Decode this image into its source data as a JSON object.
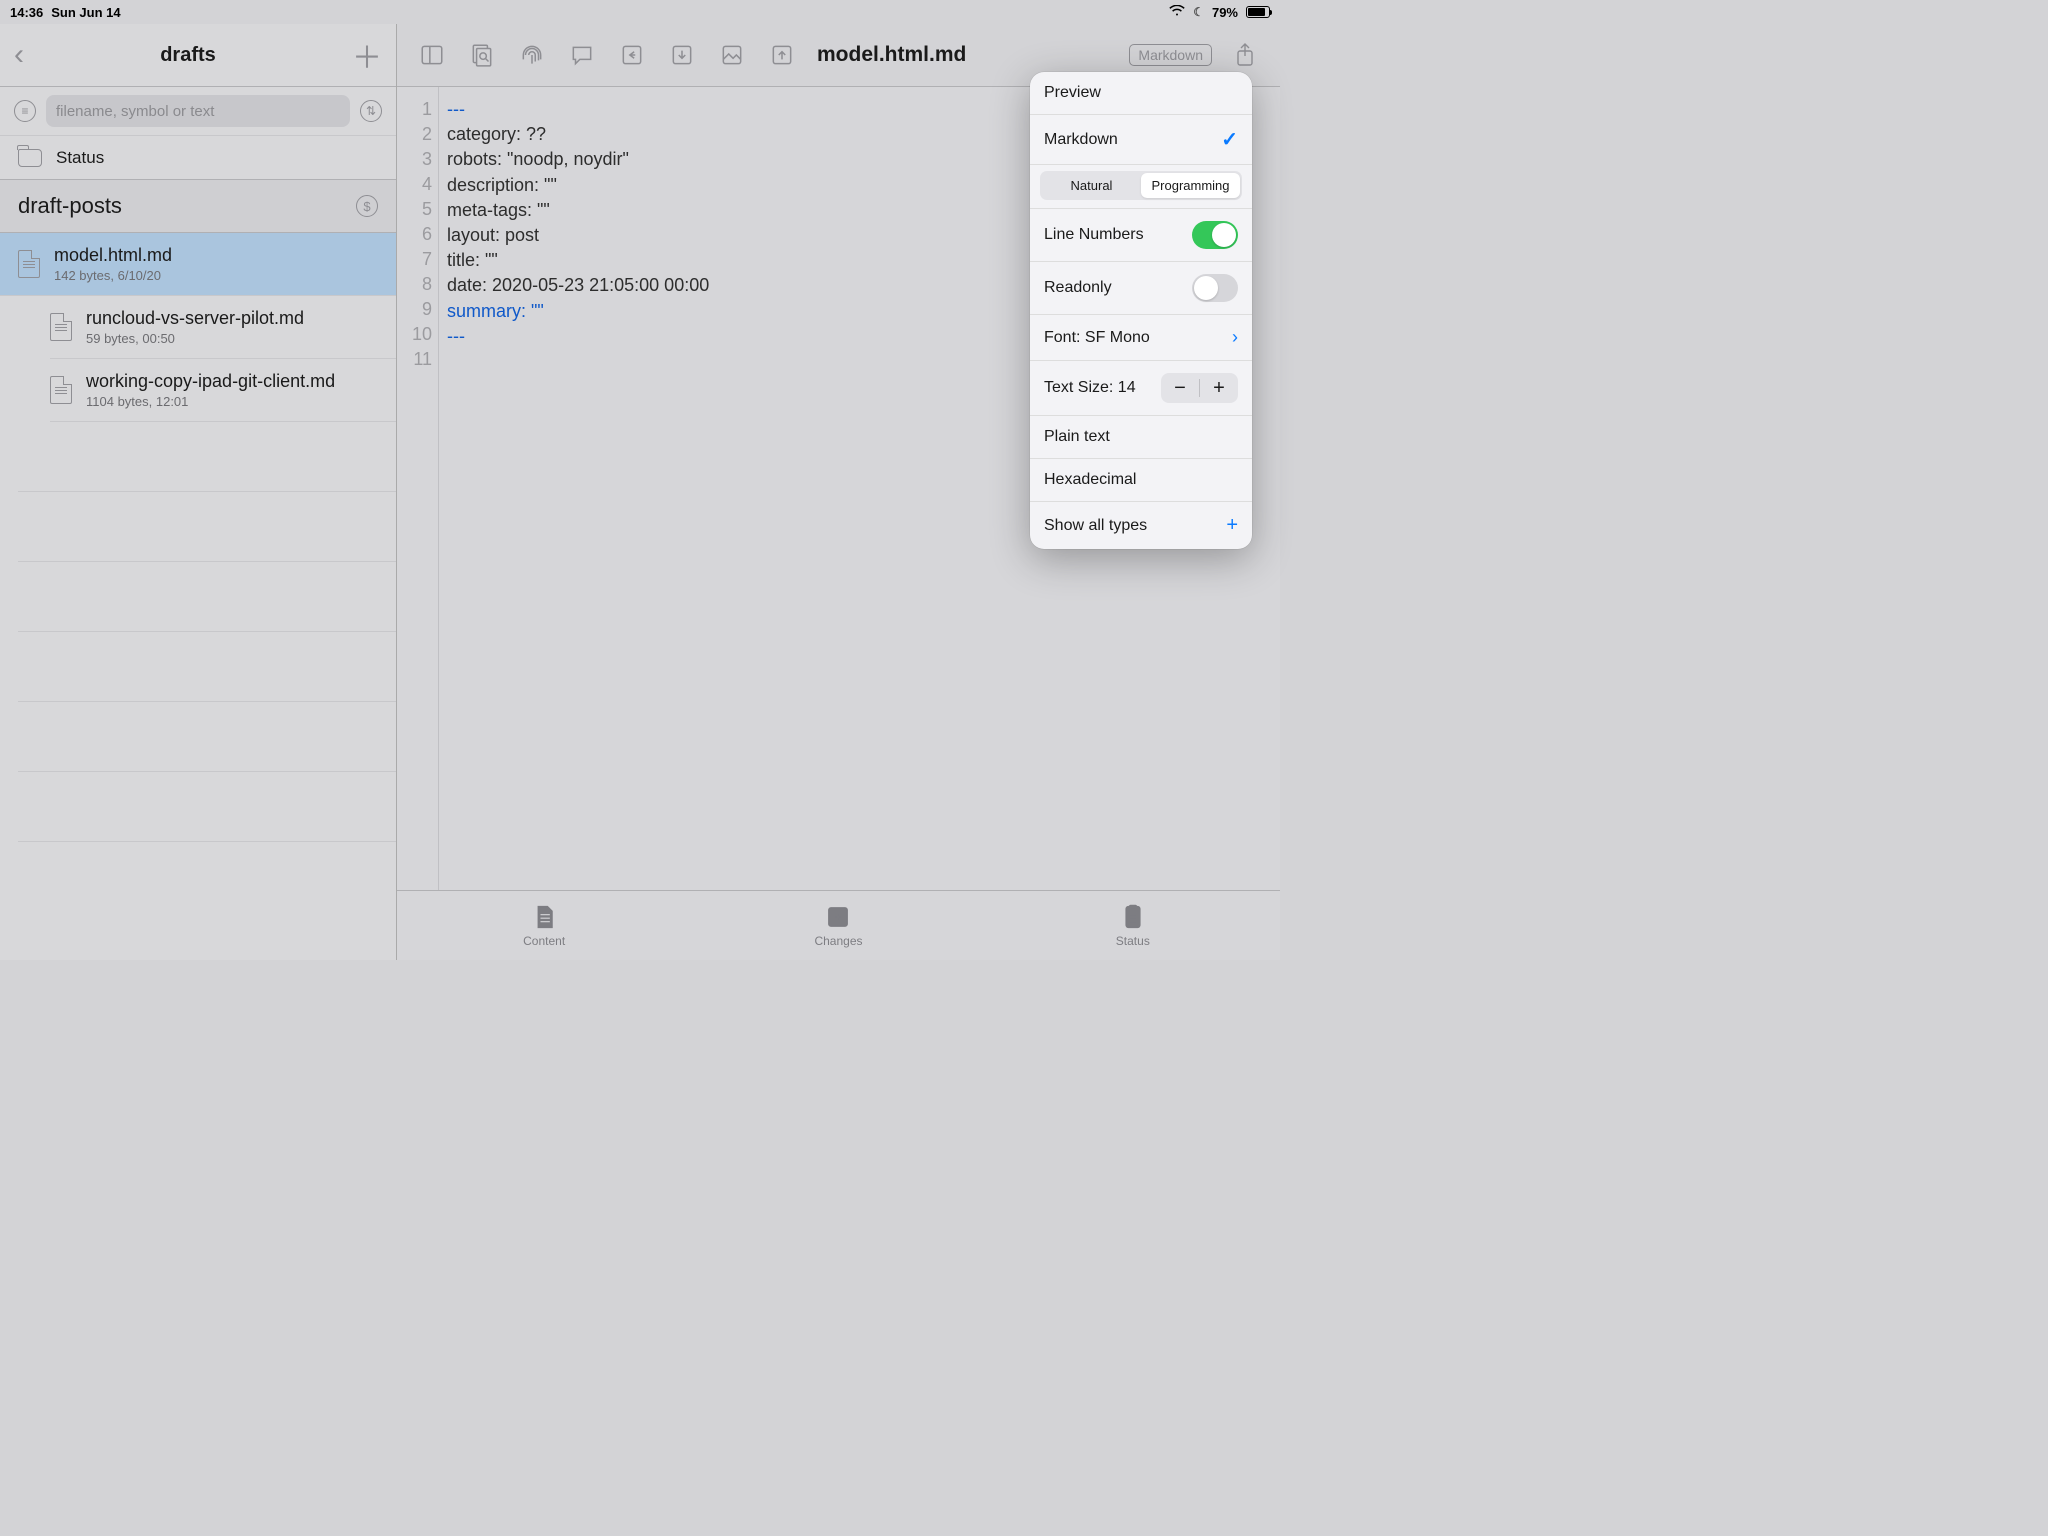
{
  "status_bar": {
    "time": "14:36",
    "date": "Sun Jun 14",
    "battery_pct": "79%"
  },
  "left": {
    "title": "drafts",
    "search_placeholder": "filename, symbol or text",
    "status_label": "Status",
    "section": "draft-posts",
    "files": [
      {
        "name": "model.html.md",
        "meta": "142 bytes, 6/10/20",
        "selected": true
      },
      {
        "name": "runcloud-vs-server-pilot.md",
        "meta": "59 bytes, 00:50",
        "selected": false
      },
      {
        "name": "working-copy-ipad-git-client.md",
        "meta": "1104 bytes, 12:01",
        "selected": false
      }
    ]
  },
  "editor": {
    "filename": "model.html.md",
    "badge": "Markdown",
    "lines": [
      "---",
      "category: ??",
      "robots: \"noodp, noydir\"",
      "description: \"\"",
      "meta-tags: \"\"",
      "layout: post",
      "title: \"\"",
      "date: 2020-05-23 21:05:00 00:00",
      "summary: \"\"",
      "---",
      ""
    ]
  },
  "tabs": [
    {
      "label": "Content"
    },
    {
      "label": "Changes"
    },
    {
      "label": "Status"
    }
  ],
  "popover": {
    "preview": "Preview",
    "markdown": "Markdown",
    "seg_natural": "Natural",
    "seg_programming": "Programming",
    "line_numbers_label": "Line Numbers",
    "readonly_label": "Readonly",
    "font_label": "Font: SF Mono",
    "text_size_label": "Text Size: 14",
    "plain_text": "Plain text",
    "hex": "Hexadecimal",
    "show_all": "Show all types"
  }
}
